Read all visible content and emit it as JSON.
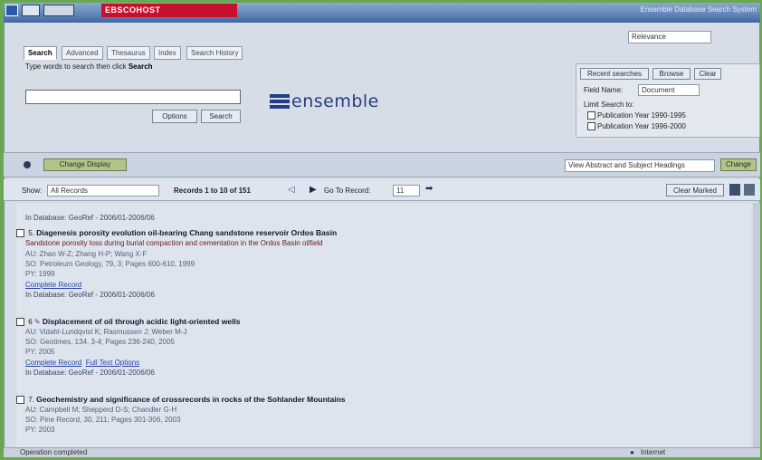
{
  "app": {
    "brand": "EBSCOHOST",
    "window_right_text": "Ensemble Database Search System"
  },
  "tabs": [
    "Search",
    "Advanced",
    "Thesaurus",
    "Index",
    "Search History"
  ],
  "active_tab": 0,
  "top_select": "Relevance",
  "search": {
    "hint": "Type words to search then click",
    "hint_bold": "Search",
    "value": "",
    "buttons": [
      "Options",
      "Search"
    ]
  },
  "logo": {
    "text": "ensemble"
  },
  "limit_panel": {
    "header_buttons": [
      "Recent searches",
      "Browse",
      "Clear"
    ],
    "field_label": "Field Name:",
    "field_value": "Document",
    "limit_label": "Limit Search to:",
    "options": [
      "Publication Year 1990-1995",
      "Publication Year 1996-2000"
    ]
  },
  "bar": {
    "button": "Change Display",
    "dropdown": "View Abstract and Subject Headings",
    "right_button": "Change"
  },
  "toolbar": {
    "show_label": "Show:",
    "show_value": "All Records",
    "records_text": "Records 1 to 10 of 151",
    "goto_label": "Go To Record:",
    "goto_value": "11",
    "right_button": "Clear Marked"
  },
  "results": [
    {
      "kind": "db_only",
      "db": "In Database: GeoRef - 2006/01-2006/06"
    },
    {
      "kind": "record",
      "num": "5",
      "title": "Diagenesis porosity evolution oil-bearing Chang sandstone reservoir Ordos Basin",
      "excerpt": "Sandstone porosity loss during burial compaction and cementation in the Ordos Basin oilfield",
      "au": "AU: Zhao W-Z; Zhang H-P; Wang X-F",
      "so": "SO: Petroleum Geology, 79, 3; Pages 600-610, 1999",
      "py": "PY: 1999",
      "links": [
        "Complete Record"
      ],
      "db": "In Database: GeoRef - 2006/01-2006/06"
    },
    {
      "kind": "record",
      "num": "6",
      "title": "Displacement of oil through acidic light-oriented wells",
      "au": "AU: Vidahl-Lundqvist K; Rasmussen J; Weber M-J",
      "so": "SO: Geotimes, 134, 3-4; Pages 236-240, 2005",
      "py": "PY: 2005",
      "links": [
        "Complete Record",
        "Full Text Options"
      ],
      "db": "In Database: GeoRef - 2006/01-2006/06"
    },
    {
      "kind": "record",
      "num": "7",
      "title": "Geochemistry and significance of crossrecords in rocks of the Sohlander Mountains",
      "au": "AU: Campbell M; Shepperd D-S; Chandler G-H",
      "so": "SO: Pine Record, 30, 211; Pages 301-306, 2003",
      "py": "PY: 2003",
      "links": [],
      "db": ""
    }
  ],
  "status": {
    "left": "Operation completed",
    "right": "Internet"
  }
}
